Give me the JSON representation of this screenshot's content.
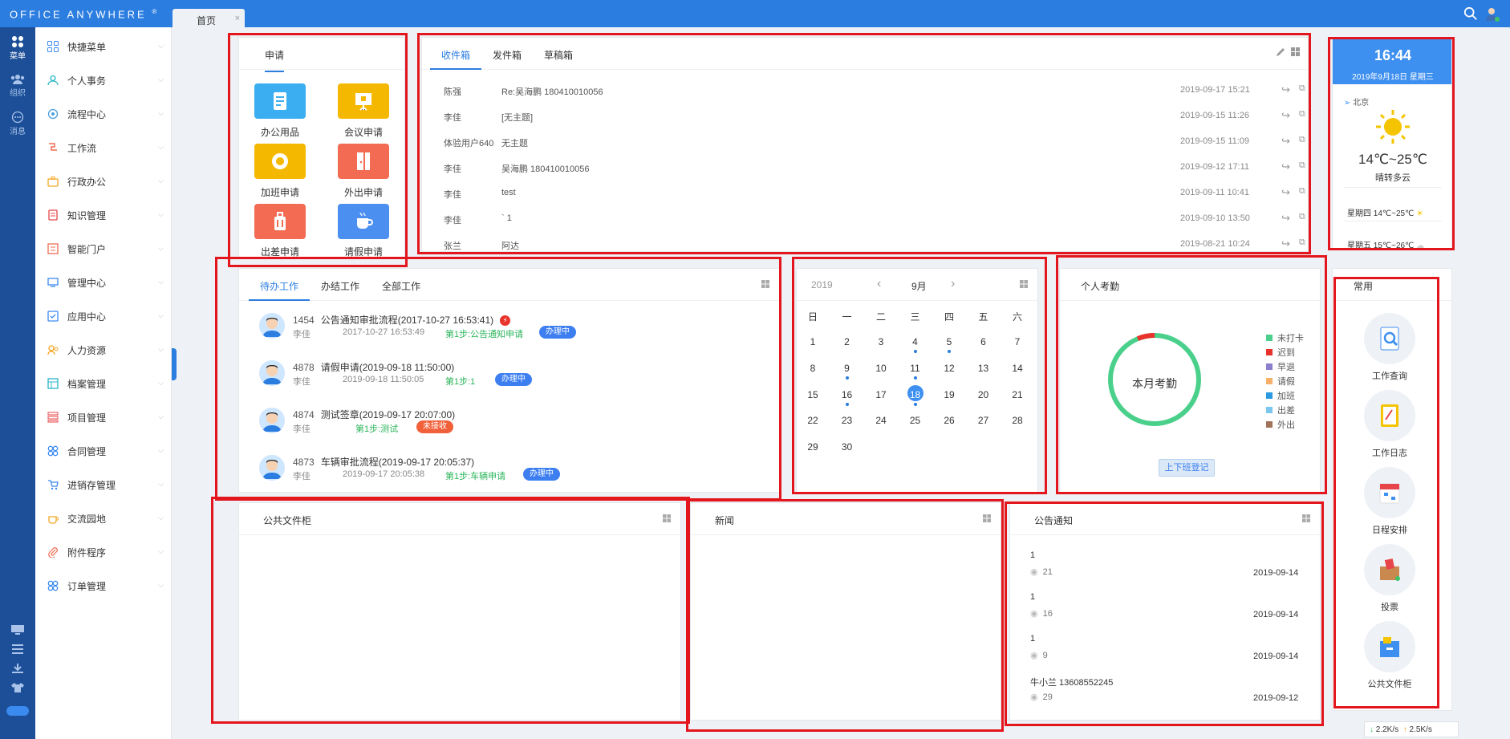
{
  "app": {
    "logo": "Office Anywhere",
    "logo_mark": "®"
  },
  "tab": {
    "label": "首页",
    "close": "×"
  },
  "leftbar": [
    {
      "label": "菜单",
      "icon": "apps-icon"
    },
    {
      "label": "组织",
      "icon": "org-icon"
    },
    {
      "label": "消息",
      "icon": "message-icon"
    }
  ],
  "menu": [
    {
      "label": "快捷菜单",
      "icon": "shortcut-icon"
    },
    {
      "label": "个人事务",
      "icon": "user-icon"
    },
    {
      "label": "流程中心",
      "icon": "flow-icon"
    },
    {
      "label": "工作流",
      "icon": "workflow-icon"
    },
    {
      "label": "行政办公",
      "icon": "admin-icon"
    },
    {
      "label": "知识管理",
      "icon": "knowledge-icon"
    },
    {
      "label": "智能门户",
      "icon": "portal-icon"
    },
    {
      "label": "管理中心",
      "icon": "manage-icon"
    },
    {
      "label": "应用中心",
      "icon": "app-center-icon"
    },
    {
      "label": "人力资源",
      "icon": "hr-icon"
    },
    {
      "label": "档案管理",
      "icon": "archive-icon"
    },
    {
      "label": "项目管理",
      "icon": "project-icon"
    },
    {
      "label": "合同管理",
      "icon": "contract-icon"
    },
    {
      "label": "进销存管理",
      "icon": "inventory-icon"
    },
    {
      "label": "交流园地",
      "icon": "community-icon"
    },
    {
      "label": "附件程序",
      "icon": "attachment-icon"
    },
    {
      "label": "订单管理",
      "icon": "order-icon"
    }
  ],
  "apply": {
    "title": "申请",
    "items": [
      {
        "label": "办公用品",
        "color": "#3aaef0",
        "icon": "notebook-icon"
      },
      {
        "label": "会议申请",
        "color": "#f5b800",
        "icon": "presentation-icon"
      },
      {
        "label": "加班申请",
        "color": "#f5b800",
        "icon": "clock-icon"
      },
      {
        "label": "外出申请",
        "color": "#f26b52",
        "icon": "door-icon"
      },
      {
        "label": "出差申请",
        "color": "#f26b52",
        "icon": "luggage-icon"
      },
      {
        "label": "请假申请",
        "color": "#4b8ff0",
        "icon": "coffee-icon"
      }
    ]
  },
  "mail": {
    "tabs": [
      "收件箱",
      "发件箱",
      "草稿箱"
    ],
    "rows": [
      {
        "from": "陈强",
        "subject": "Re:吴海鹏 180410010056",
        "time": "2019-09-17 15:21"
      },
      {
        "from": "李佳",
        "subject": "[无主题]",
        "time": "2019-09-15 11:26"
      },
      {
        "from": "体验用户640",
        "subject": "无主题",
        "time": "2019-09-15 11:09"
      },
      {
        "from": "李佳",
        "subject": "吴海鹏 180410010056",
        "time": "2019-09-12 17:11"
      },
      {
        "from": "李佳",
        "subject": "test",
        "time": "2019-09-11 10:41"
      },
      {
        "from": "李佳",
        "subject": "` 1",
        "time": "2019-09-10 13:50"
      },
      {
        "from": "张兰",
        "subject": "阿达",
        "time": "2019-08-21 10:24"
      }
    ]
  },
  "weather": {
    "time": "16:44",
    "date": "2019年9月18日  星期三",
    "city": "北京",
    "temp": "14℃~25℃",
    "desc": "晴转多云",
    "forecast": [
      {
        "text": "星期四 14℃~25℃"
      },
      {
        "text": "星期五 15℃~26℃"
      }
    ]
  },
  "todo": {
    "tabs": [
      "待办工作",
      "办结工作",
      "全部工作"
    ],
    "rows": [
      {
        "id": "1454",
        "title": "公告通知审批流程(2017-10-27 16:53:41)",
        "user": "李佳",
        "time": "2017-10-27 16:53:49",
        "step": "第1步:公告通知申请",
        "status": "办理中",
        "status_color": "#3d7ff0",
        "urgent": true
      },
      {
        "id": "4878",
        "title": "请假申请(2019-09-18 11:50:00)",
        "user": "李佳",
        "time": "2019-09-18 11:50:05",
        "step": "第1步:1",
        "status": "办理中",
        "status_color": "#3d7ff0",
        "urgent": false
      },
      {
        "id": "4874",
        "title": "测试签章(2019-09-17 20:07:00)",
        "user": "李佳",
        "time": "",
        "step": "第1步:测试",
        "status": "未接收",
        "status_color": "#f2603a",
        "urgent": false
      },
      {
        "id": "4873",
        "title": "车辆审批流程(2019-09-17 20:05:37)",
        "user": "李佳",
        "time": "2019-09-17 20:05:38",
        "step": "第1步:车辆申请",
        "status": "办理中",
        "status_color": "#3d7ff0",
        "urgent": false
      }
    ]
  },
  "calendar": {
    "year": "2019",
    "month": "9月",
    "weekdays": [
      "日",
      "一",
      "二",
      "三",
      "四",
      "五",
      "六"
    ],
    "days": [
      [
        "1",
        "2",
        "3",
        "4",
        "5",
        "6",
        "7"
      ],
      [
        "8",
        "9",
        "10",
        "11",
        "12",
        "13",
        "14"
      ],
      [
        "15",
        "16",
        "17",
        "18",
        "19",
        "20",
        "21"
      ],
      [
        "22",
        "23",
        "24",
        "25",
        "26",
        "27",
        "28"
      ],
      [
        "29",
        "30",
        "",
        "",
        "",
        "",
        ""
      ]
    ],
    "today": "18",
    "event_days": [
      "4",
      "5",
      "9",
      "11",
      "16",
      "18"
    ]
  },
  "attendance": {
    "title": "个人考勤",
    "center": "本月考勤",
    "button": "上下班登记",
    "legend": [
      {
        "label": "未打卡",
        "color": "#4bd08c"
      },
      {
        "label": "迟到",
        "color": "#e8322a"
      },
      {
        "label": "早退",
        "color": "#8b7fd0"
      },
      {
        "label": "请假",
        "color": "#f5b06a"
      },
      {
        "label": "加班",
        "color": "#2b9ae0"
      },
      {
        "label": "出差",
        "color": "#7cc7ef"
      },
      {
        "label": "外出",
        "color": "#a0735a"
      }
    ]
  },
  "common": {
    "title": "常用",
    "items": [
      {
        "label": "工作查询",
        "icon": "doc-search-icon"
      },
      {
        "label": "工作日志",
        "icon": "journal-icon"
      },
      {
        "label": "日程安排",
        "icon": "calendar-icon"
      },
      {
        "label": "投票",
        "icon": "vote-icon"
      },
      {
        "label": "公共文件柜",
        "icon": "cabinet-icon"
      }
    ]
  },
  "files": {
    "title": "公共文件柜"
  },
  "news": {
    "title": "新闻"
  },
  "notices": {
    "title": "公告通知",
    "rows": [
      {
        "title": "1",
        "views": "21",
        "date": "2019-09-14"
      },
      {
        "title": "1",
        "views": "16",
        "date": "2019-09-14"
      },
      {
        "title": "1",
        "views": "9",
        "date": "2019-09-14"
      },
      {
        "title": "牛小兰 13608552245",
        "views": "29",
        "date": "2019-09-12"
      }
    ]
  },
  "net": {
    "down": "2.2K/s",
    "up": "2.5K/s"
  }
}
